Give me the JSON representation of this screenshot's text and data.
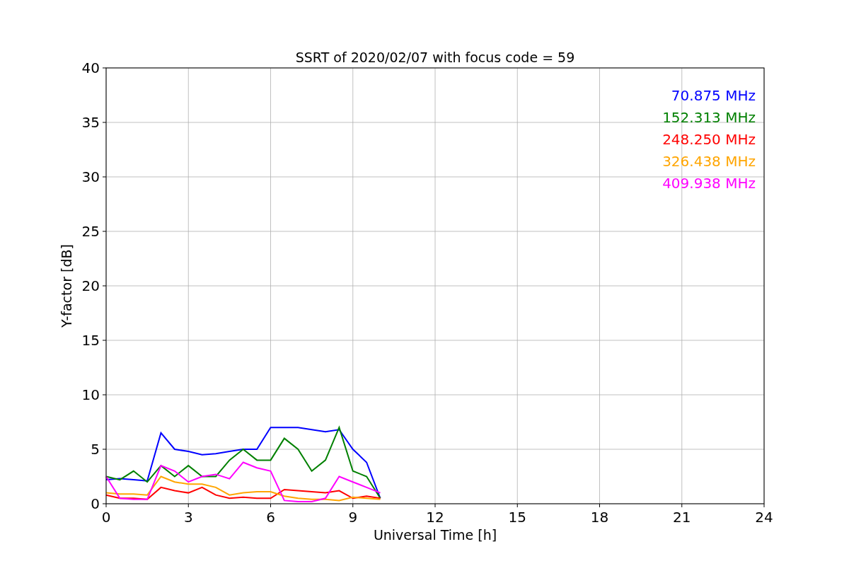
{
  "figure": {
    "chart_data": {
      "type": "line",
      "title": "SSRT of 2020/02/07 with focus code = 59",
      "xlabel": "Universal Time [h]",
      "ylabel": "Y-factor [dB]",
      "x": [
        0,
        0.5,
        1,
        1.5,
        2,
        2.5,
        3,
        3.5,
        4,
        4.5,
        5,
        5.5,
        6,
        6.5,
        7,
        7.5,
        8,
        8.5,
        9,
        9.5,
        10
      ],
      "series": [
        {
          "name": "70.875 MHz",
          "color": "#0000ff",
          "values": [
            2.2,
            2.3,
            2.2,
            2.1,
            6.5,
            5,
            4.8,
            4.5,
            4.6,
            4.8,
            5,
            5,
            7,
            7,
            7,
            6.8,
            6.6,
            6.8,
            5,
            3.8,
            0.5
          ]
        },
        {
          "name": "152.313 MHz",
          "color": "#008000",
          "values": [
            2.5,
            2.2,
            3,
            2,
            3.5,
            2.5,
            3.5,
            2.5,
            2.5,
            4,
            5,
            4,
            4,
            6,
            5,
            3,
            4,
            7,
            3,
            2.5,
            0.5
          ]
        },
        {
          "name": "248.250 MHz",
          "color": "#ff0000",
          "values": [
            0.8,
            0.5,
            0.5,
            0.4,
            1.5,
            1.2,
            1,
            1.5,
            0.8,
            0.5,
            0.6,
            0.5,
            0.5,
            1.3,
            1.2,
            1.1,
            1,
            1.2,
            0.5,
            0.7,
            0.5
          ]
        },
        {
          "name": "326.438 MHz",
          "color": "#ffa500",
          "values": [
            1,
            0.9,
            0.9,
            0.8,
            2.5,
            2,
            1.8,
            1.8,
            1.5,
            0.8,
            1,
            1.1,
            1.1,
            0.7,
            0.5,
            0.4,
            0.4,
            0.3,
            0.6,
            0.5,
            0.4
          ]
        },
        {
          "name": "409.938 MHz",
          "color": "#ff00ff",
          "values": [
            2.5,
            0.5,
            0.4,
            0.4,
            3.5,
            3,
            2,
            2.5,
            2.7,
            2.3,
            3.8,
            3.3,
            3,
            0.3,
            0.2,
            0.2,
            0.5,
            2.5,
            2,
            1.5,
            1
          ]
        }
      ],
      "grid": true,
      "xlim": [
        0,
        24
      ],
      "ylim": [
        0,
        40
      ],
      "xticks": [
        0,
        3,
        6,
        9,
        12,
        15,
        18,
        21,
        24
      ],
      "yticks": [
        0,
        5,
        10,
        15,
        20,
        25,
        30,
        35,
        40
      ]
    }
  }
}
